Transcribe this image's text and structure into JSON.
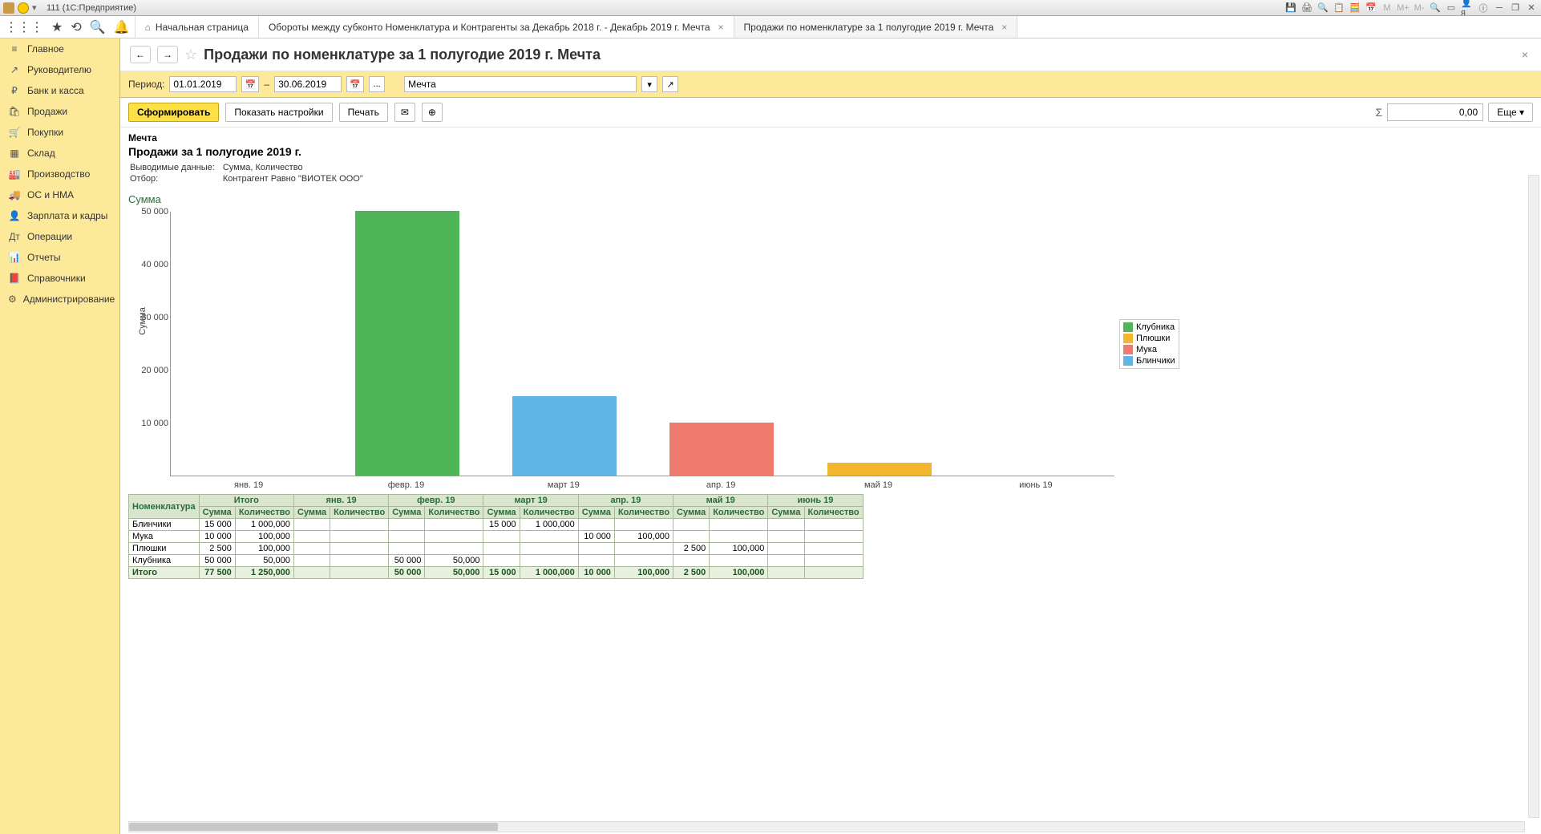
{
  "window": {
    "title": "111  (1С:Предприятие)"
  },
  "tabs": [
    {
      "label": "Начальная страница",
      "home": true
    },
    {
      "label": "Обороты между субконто Номенклатура и Контрагенты за Декабрь 2018 г. - Декабрь 2019 г. Мечта",
      "closable": true
    },
    {
      "label": "Продажи по номенклатуре за 1 полугодие 2019 г. Мечта",
      "closable": true,
      "active": true
    }
  ],
  "sidebar": {
    "items": [
      {
        "icon": "≡",
        "label": "Главное"
      },
      {
        "icon": "↗",
        "label": "Руководителю"
      },
      {
        "icon": "₽",
        "label": "Банк и касса"
      },
      {
        "icon": "🛍",
        "label": "Продажи"
      },
      {
        "icon": "🛒",
        "label": "Покупки"
      },
      {
        "icon": "▦",
        "label": "Склад"
      },
      {
        "icon": "🏭",
        "label": "Производство"
      },
      {
        "icon": "🚚",
        "label": "ОС и НМА"
      },
      {
        "icon": "👤",
        "label": "Зарплата и кадры"
      },
      {
        "icon": "Дт",
        "label": "Операции"
      },
      {
        "icon": "📊",
        "label": "Отчеты"
      },
      {
        "icon": "📕",
        "label": "Справочники"
      },
      {
        "icon": "⚙",
        "label": "Администрирование"
      }
    ]
  },
  "page": {
    "title": "Продажи по номенклатуре за 1 полугодие 2019 г. Мечта",
    "period_label": "Период:",
    "date_from": "01.01.2019",
    "date_to": "30.06.2019",
    "org": "Мечта",
    "btn_form": "Сформировать",
    "btn_settings": "Показать настройки",
    "btn_print": "Печать",
    "btn_more": "Еще",
    "sum_sign": "Σ",
    "sum_value": "0,00"
  },
  "report": {
    "org": "Мечта",
    "title": "Продажи за 1 полугодие 2019 г.",
    "meta1_label": "Выводимые данные:",
    "meta1_value": "Сумма, Количество",
    "meta2_label": "Отбор:",
    "meta2_value": "Контрагент Равно \"ВИОТЕК ООО\""
  },
  "chart_data": {
    "type": "bar",
    "title": "Сумма",
    "ylabel": "Сумма",
    "ylim": [
      0,
      50000
    ],
    "yticks": [
      10000,
      20000,
      30000,
      40000,
      50000
    ],
    "ytick_labels": [
      "10 000",
      "20 000",
      "30 000",
      "40 000",
      "50 000"
    ],
    "categories": [
      "янв. 19",
      "февр. 19",
      "март 19",
      "апр. 19",
      "май 19",
      "июнь 19"
    ],
    "series": [
      {
        "name": "Клубника",
        "color": "#4fb558",
        "values": [
          0,
          50000,
          0,
          0,
          0,
          0
        ]
      },
      {
        "name": "Плюшки",
        "color": "#f3b62f",
        "values": [
          0,
          0,
          0,
          0,
          2500,
          0
        ]
      },
      {
        "name": "Мука",
        "color": "#ef7a6e",
        "values": [
          0,
          0,
          0,
          10000,
          0,
          0
        ]
      },
      {
        "name": "Блинчики",
        "color": "#5db6e6",
        "values": [
          0,
          0,
          15000,
          0,
          0,
          0
        ]
      }
    ]
  },
  "table": {
    "headers": {
      "nomen": "Номенклатура",
      "itogo": "Итого",
      "sum": "Сумма",
      "qty": "Количество",
      "months": [
        "янв. 19",
        "февр. 19",
        "март 19",
        "апр. 19",
        "май 19",
        "июнь 19"
      ]
    },
    "rows": [
      {
        "name": "Блинчики",
        "total_sum": "15 000",
        "total_qty": "1 000,000",
        "cells": [
          "",
          "",
          "",
          "",
          "15 000",
          "1 000,000",
          "",
          "",
          "",
          "",
          "",
          ""
        ]
      },
      {
        "name": "Мука",
        "total_sum": "10 000",
        "total_qty": "100,000",
        "cells": [
          "",
          "",
          "",
          "",
          "",
          "",
          "10 000",
          "100,000",
          "",
          "",
          "",
          ""
        ]
      },
      {
        "name": "Плюшки",
        "total_sum": "2 500",
        "total_qty": "100,000",
        "cells": [
          "",
          "",
          "",
          "",
          "",
          "",
          "",
          "",
          "2 500",
          "100,000",
          "",
          ""
        ]
      },
      {
        "name": "Клубника",
        "total_sum": "50 000",
        "total_qty": "50,000",
        "cells": [
          "",
          "",
          "50 000",
          "50,000",
          "",
          "",
          "",
          "",
          "",
          "",
          "",
          ""
        ]
      }
    ],
    "total": {
      "name": "Итого",
      "total_sum": "77 500",
      "total_qty": "1 250,000",
      "cells": [
        "",
        "",
        "50 000",
        "50,000",
        "15 000",
        "1 000,000",
        "10 000",
        "100,000",
        "2 500",
        "100,000",
        "",
        ""
      ]
    }
  }
}
